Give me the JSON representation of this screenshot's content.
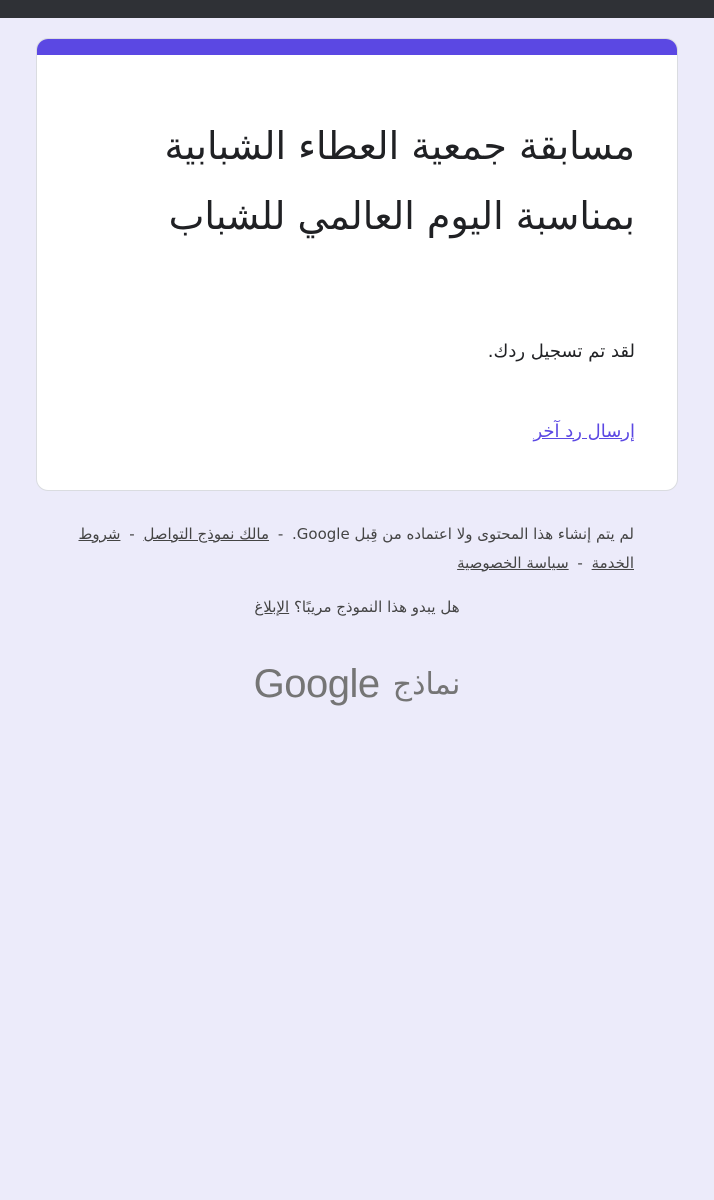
{
  "form": {
    "title": "مسابقة جمعية العطاء الشبابية بمناسبة اليوم العالمي للشباب",
    "confirmation": "لقد تم تسجيل ردك.",
    "another_response_link": "إرسال رد آخر",
    "accent_color": "#5b48e3"
  },
  "footer": {
    "disclaimer": "لم يتم إنشاء هذا المحتوى ولا اعتماده من قِبل Google.",
    "separator": "-",
    "contact_owner_link": "مالك نموذج التواصل",
    "terms_link": "شروط الخدمة",
    "privacy_link": "سياسة الخصوصية",
    "abuse_question": "هل يبدو هذا النموذج مريبًا؟",
    "report_link": "الإبلاغ"
  },
  "logo": {
    "brand": "Google",
    "product": "نماذج"
  }
}
